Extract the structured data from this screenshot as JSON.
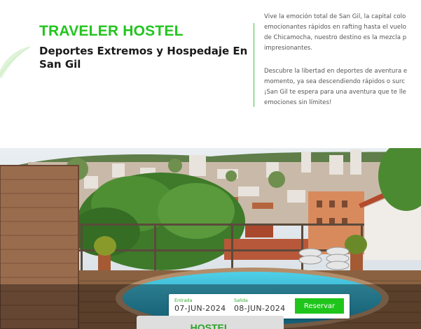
{
  "brand": {
    "name": "TRAVELER HOSTEL",
    "accent": "#22c51e"
  },
  "hero": {
    "subtitle": "Deportes Extremos y Hospedaje En San Gil",
    "paragraph1": [
      "Vive la emoción total de San Gil, la capital colo",
      "emocionantes rápidos en rafting hasta el vuelo",
      "de Chicamocha, nuestro destino es la mezcla p",
      "impresionantes."
    ],
    "paragraph2": [
      "Descubre la libertad en deportes de aventura e",
      "momento, ya sea descendiendo rápidos o surc",
      "¡San Gil te espera para una aventura que te lle",
      "emociones sin límites!"
    ]
  },
  "booking": {
    "checkin_label": "Entrada",
    "checkin_value": "07-JUN-2024",
    "checkout_label": "Salida",
    "checkout_value": "08-JUN-2024",
    "reserve_label": "Reservar"
  },
  "next_section": {
    "title": "HOSTEL"
  }
}
